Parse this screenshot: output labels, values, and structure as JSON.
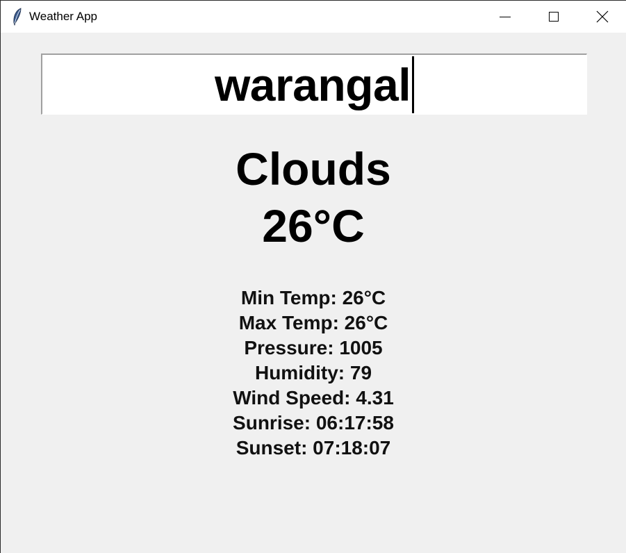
{
  "window": {
    "title": "Weather App",
    "controls": {
      "minimize_icon": "minimize-icon",
      "maximize_icon": "maximize-icon",
      "close_icon": "close-icon"
    },
    "app_icon": "feather-icon"
  },
  "search": {
    "value": "warangal"
  },
  "weather": {
    "condition": "Clouds",
    "temperature": "26°C"
  },
  "details": {
    "min_temp": "Min Temp: 26°C",
    "max_temp": "Max Temp: 26°C",
    "pressure": "Pressure: 1005",
    "humidity": "Humidity: 79",
    "wind_speed": "Wind Speed: 4.31",
    "sunrise": "Sunrise: 06:17:58",
    "sunset": "Sunset: 07:18:07"
  },
  "colors": {
    "background": "#f0f0f0",
    "titlebar": "#ffffff",
    "text": "#000000"
  }
}
